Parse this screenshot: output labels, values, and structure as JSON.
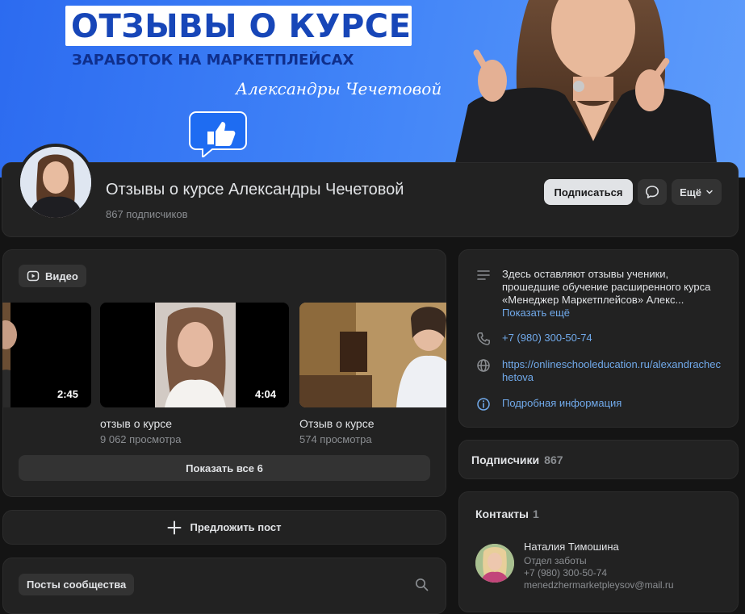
{
  "cover": {
    "title": "ОТЗЫВЫ О КУРСЕ",
    "subtitle": "ЗАРАБОТОК НА МАРКЕТПЛЕЙСАХ",
    "author": "Александры Чечетовой"
  },
  "header": {
    "channel_name": "Отзывы о курсе Александры Чечетовой",
    "subscribers": "867 подписчиков",
    "subscribe_label": "Подписаться",
    "more_label": "Ещё"
  },
  "videos": {
    "section_label": "Видео",
    "items": [
      {
        "title": "",
        "views": "",
        "duration": "2:45"
      },
      {
        "title": "отзыв о курсе",
        "views": "9 062 просмотра",
        "duration": "4:04"
      },
      {
        "title": "Отзыв о курсе",
        "views": "574 просмотра",
        "duration": ""
      }
    ],
    "show_all_label": "Показать все 6"
  },
  "suggest_post_label": "Предложить пост",
  "posts": {
    "label": "Посты сообщества"
  },
  "info": {
    "description": "Здесь оставляют отзывы ученики, прошедшие обучение расширенного курса «Менеджер Маркетплейсов» Алекс...",
    "show_more": "Показать ещё",
    "phone": "+7 (980) 300-50-74",
    "website": "https://onlineschooleducation.ru/alexandrachechetova",
    "details": "Подробная информация"
  },
  "subscribers_block": {
    "label": "Подписчики",
    "count": "867"
  },
  "contacts": {
    "label": "Контакты",
    "count": "1",
    "person": {
      "name": "Наталия Тимошина",
      "role": "Отдел заботы",
      "phone": "+7 (980) 300-50-74",
      "email": "menedzhermarketpleysov@mail.ru"
    }
  },
  "colors": {
    "accent_link": "#71aaeb",
    "background": "#141414",
    "card": "#222222"
  }
}
